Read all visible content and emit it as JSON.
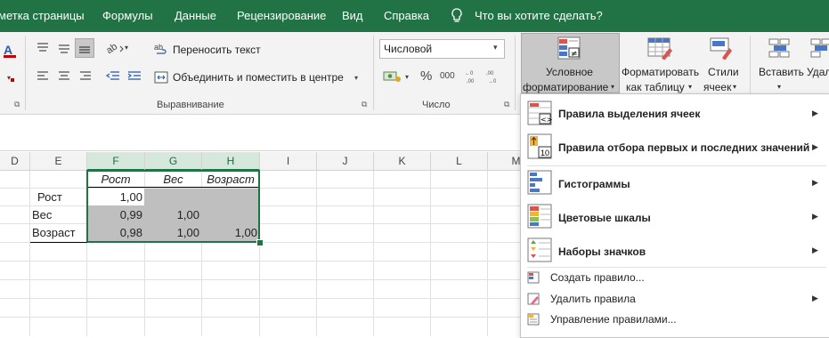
{
  "menu": {
    "tabs": [
      "метка страницы",
      "Формулы",
      "Данные",
      "Рецензирование",
      "Вид",
      "Справка"
    ],
    "tell_me": "Что вы хотите сделать?"
  },
  "ribbon": {
    "wrap_text": "Переносить текст",
    "merge_center": "Объединить и поместить в центре",
    "alignment_group": "Выравнивание",
    "number_format": "Числовой",
    "number_group": "Число",
    "percent": "%",
    "thousands": "000",
    "font_a_glyph": "A",
    "conditional_line1": "Условное",
    "conditional_line2": "форматирование",
    "format_table_line1": "Форматировать",
    "format_table_line2": "как таблицу",
    "styles_line1": "Стили",
    "styles_line2": "ячеек",
    "insert": "Вставить",
    "delete": "Удал"
  },
  "sheet": {
    "columns": [
      "D",
      "E",
      "F",
      "G",
      "H",
      "I",
      "J",
      "K",
      "L",
      "M"
    ],
    "header_row": [
      "",
      "Рост",
      "Вес",
      "Возраст"
    ],
    "rows": [
      {
        "label": "Рост",
        "f": "1,00",
        "g": "",
        "h": ""
      },
      {
        "label": "Вес",
        "f": "0,99",
        "g": "1,00",
        "h": ""
      },
      {
        "label": "Возраст",
        "f": "0,98",
        "g": "1,00",
        "h": "1,00"
      }
    ]
  },
  "dropdown": {
    "items": [
      {
        "label": "Правила выделения ячеек",
        "icon": "highlight-cells-icon"
      },
      {
        "label": "Правила отбора первых и последних значений",
        "icon": "top-bottom-icon",
        "icon_text": "10"
      },
      {
        "label": "Гистограммы",
        "icon": "data-bars-icon"
      },
      {
        "label": "Цветовые шкалы",
        "icon": "color-scales-icon"
      },
      {
        "label": "Наборы значков",
        "icon": "icon-sets-icon"
      }
    ],
    "small_items": [
      {
        "label": "Создать правило...",
        "icon": "new-rule-icon"
      },
      {
        "label": "Удалить правила",
        "icon": "clear-rules-icon"
      },
      {
        "label": "Управление правилами...",
        "icon": "manage-rules-icon"
      }
    ]
  },
  "colors": {
    "excel_green": "#217346",
    "selected_fill": "#bfbfbf"
  }
}
